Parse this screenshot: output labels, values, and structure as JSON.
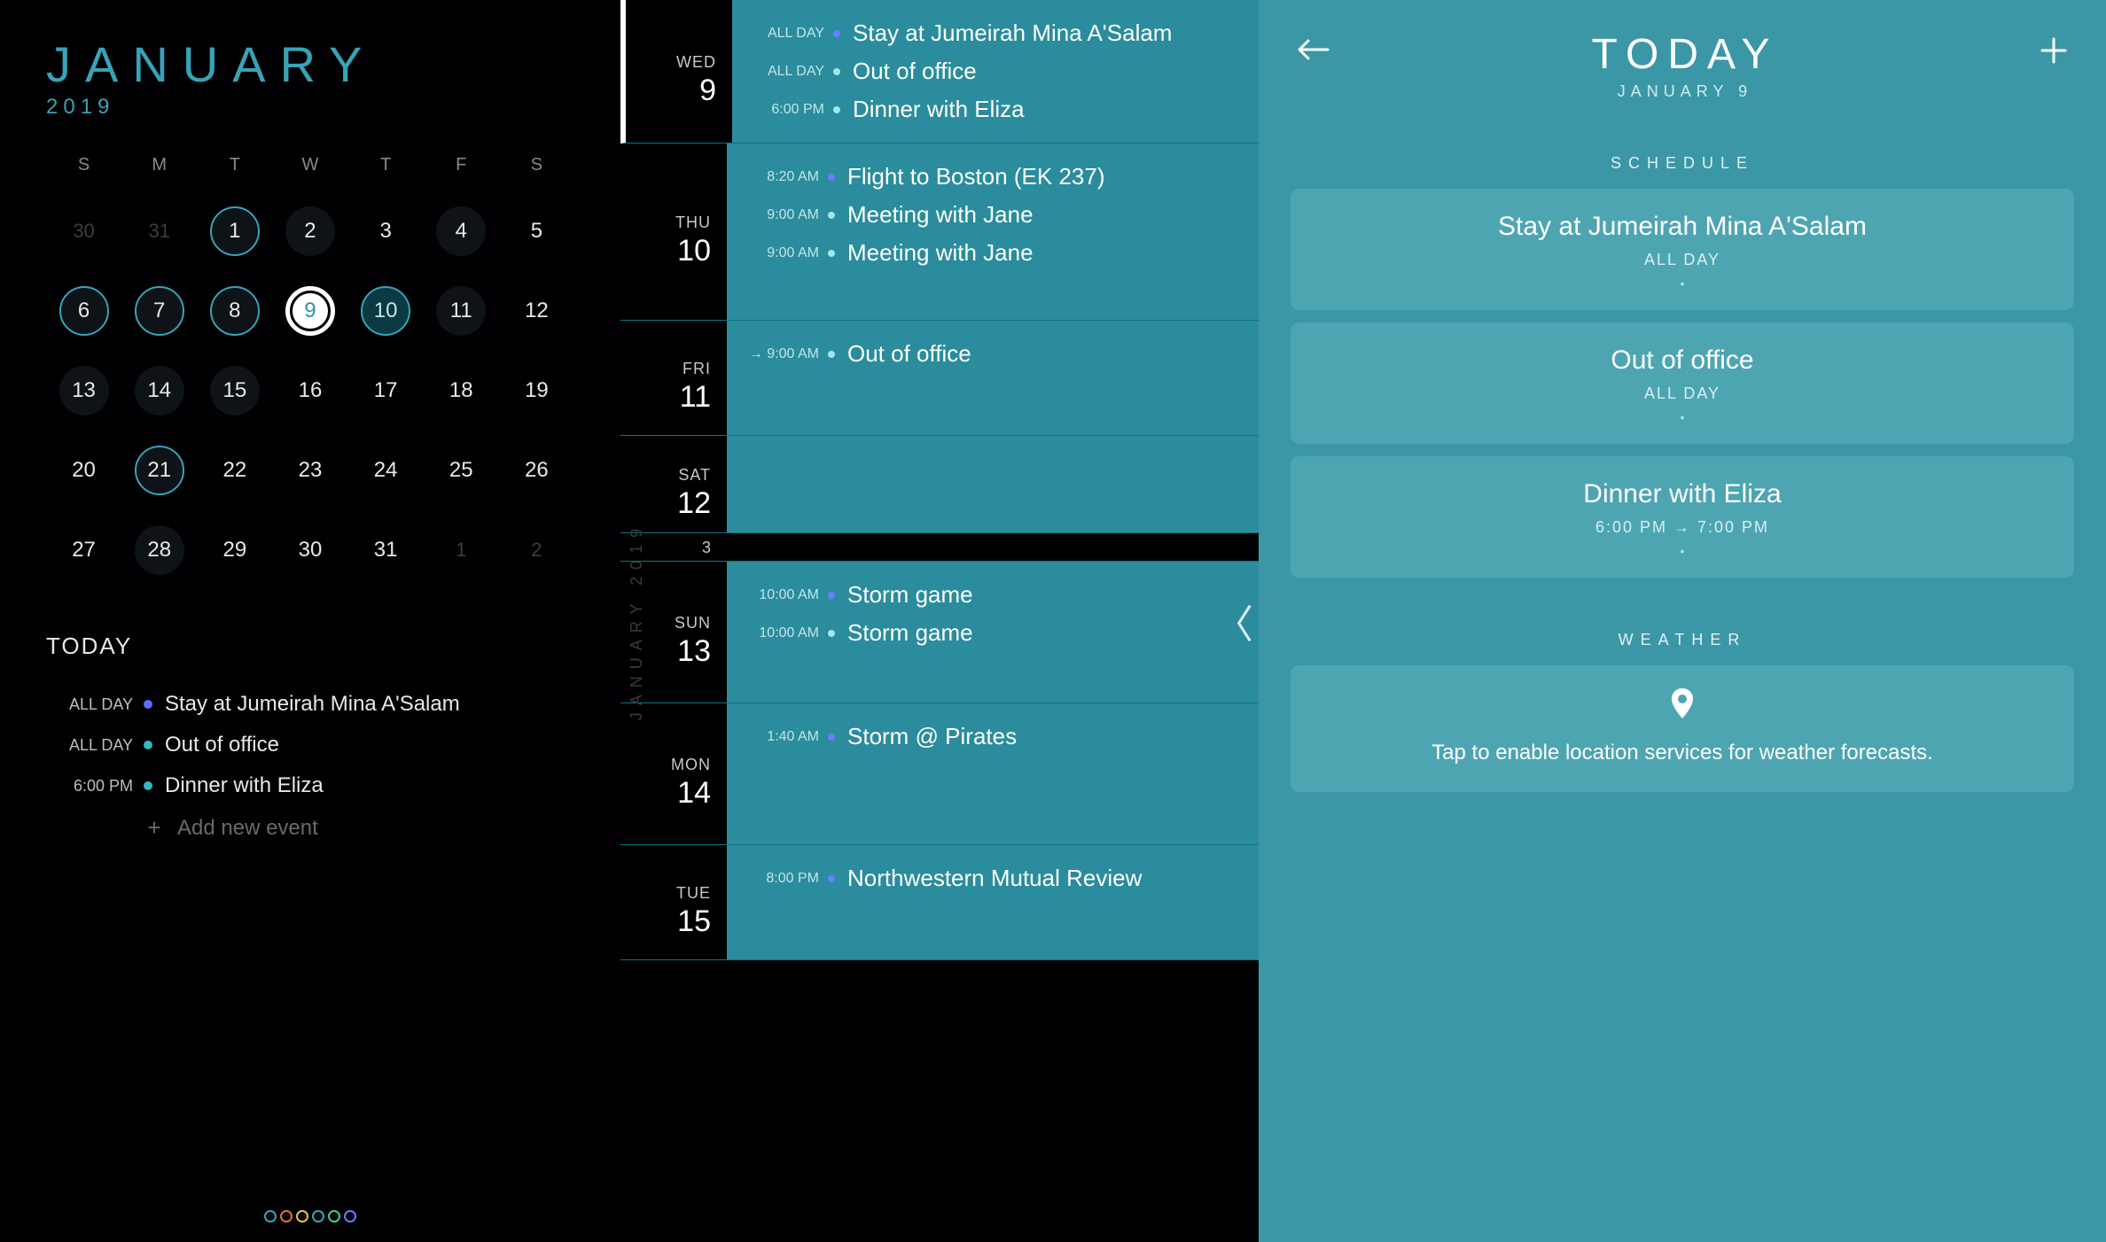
{
  "month_view": {
    "month": "JANUARY",
    "year": "2019",
    "dow": [
      "S",
      "M",
      "T",
      "W",
      "T",
      "F",
      "S"
    ],
    "today_label": "TODAY",
    "add_label": "Add new event",
    "events": [
      {
        "time": "ALL DAY",
        "dot": "blue",
        "title": "Stay at Jumeirah Mina A'Salam"
      },
      {
        "time": "ALL DAY",
        "dot": "teal",
        "title": "Out of office"
      },
      {
        "time": "6:00 PM",
        "dot": "teal",
        "title": "Dinner with Eliza"
      }
    ],
    "footer_colors": [
      "#37a3b6",
      "#e36f3b",
      "#e6c342",
      "#37a3b6",
      "#4fc787",
      "#6b7dff"
    ],
    "grid": [
      {
        "n": "30",
        "prev": true
      },
      {
        "n": "31",
        "prev": true
      },
      {
        "n": "1",
        "ring": "teal",
        "bg": true
      },
      {
        "n": "2",
        "bg": true
      },
      {
        "n": "3"
      },
      {
        "n": "4",
        "bg": true
      },
      {
        "n": "5"
      },
      {
        "n": "6",
        "ring": "teal",
        "bg": true
      },
      {
        "n": "7",
        "ring": "teal",
        "bg": true
      },
      {
        "n": "8",
        "ring": "teal",
        "bg": true
      },
      {
        "n": "9",
        "today": true
      },
      {
        "n": "10",
        "ring": "tealfill"
      },
      {
        "n": "11",
        "bg": true
      },
      {
        "n": "12"
      },
      {
        "n": "13",
        "bg": true
      },
      {
        "n": "14",
        "bg": true
      },
      {
        "n": "15",
        "bg": true
      },
      {
        "n": "16"
      },
      {
        "n": "17"
      },
      {
        "n": "18"
      },
      {
        "n": "19"
      },
      {
        "n": "20"
      },
      {
        "n": "21",
        "ring": "teal",
        "bg": true
      },
      {
        "n": "22"
      },
      {
        "n": "23"
      },
      {
        "n": "24"
      },
      {
        "n": "25"
      },
      {
        "n": "26"
      },
      {
        "n": "27"
      },
      {
        "n": "28",
        "bg": true
      },
      {
        "n": "29"
      },
      {
        "n": "30"
      },
      {
        "n": "31"
      },
      {
        "n": "1",
        "next": true
      },
      {
        "n": "2",
        "next": true
      }
    ]
  },
  "agenda": {
    "side_label": "JANUARY 2019",
    "days": [
      {
        "dow": "WED",
        "num": "9",
        "selected": true,
        "events": [
          {
            "time": "ALL DAY",
            "dot": "blue",
            "title": "Stay at Jumeirah Mina A'Salam"
          },
          {
            "time": "ALL DAY",
            "dot": "teal",
            "title": "Out of office"
          },
          {
            "time": "6:00 PM",
            "dot": "teal",
            "title": "Dinner with Eliza"
          }
        ]
      },
      {
        "dow": "THU",
        "num": "10",
        "events": [
          {
            "time": "8:20 AM",
            "dot": "blue",
            "title": "Flight to Boston (EK 237)"
          },
          {
            "time": "9:00 AM",
            "dot": "teal",
            "title": "Meeting with Jane"
          },
          {
            "time": "9:00 AM",
            "dot": "teal",
            "title": "Meeting with Jane"
          }
        ]
      },
      {
        "dow": "FRI",
        "num": "11",
        "events": [
          {
            "time": "→ 9:00 AM",
            "dot": "teal",
            "title": "Out of office"
          }
        ]
      },
      {
        "dow": "SAT",
        "num": "12",
        "events": []
      },
      {
        "dow": "",
        "num": "3",
        "small": true,
        "events": []
      },
      {
        "dow": "SUN",
        "num": "13",
        "events": [
          {
            "time": "10:00 AM",
            "dot": "blue",
            "title": "Storm game"
          },
          {
            "time": "10:00 AM",
            "dot": "teal",
            "title": "Storm game"
          }
        ]
      },
      {
        "dow": "MON",
        "num": "14",
        "events": [
          {
            "time": "1:40 AM",
            "dot": "blue",
            "title": "Storm @ Pirates"
          }
        ]
      },
      {
        "dow": "TUE",
        "num": "15",
        "events": [
          {
            "time": "8:00 PM",
            "dot": "blue",
            "title": "Northwestern Mutual Review"
          }
        ]
      }
    ]
  },
  "today": {
    "title": "TODAY",
    "subtitle": "JANUARY 9",
    "schedule_label": "SCHEDULE",
    "weather_label": "WEATHER",
    "weather_text": "Tap to enable location services for weather forecasts.",
    "cards": [
      {
        "title": "Stay at Jumeirah Mina A'Salam",
        "sub": "ALL DAY"
      },
      {
        "title": "Out of office",
        "sub": "ALL DAY"
      },
      {
        "title": "Dinner with Eliza",
        "sub": "6:00 PM → 7:00 PM"
      }
    ]
  }
}
